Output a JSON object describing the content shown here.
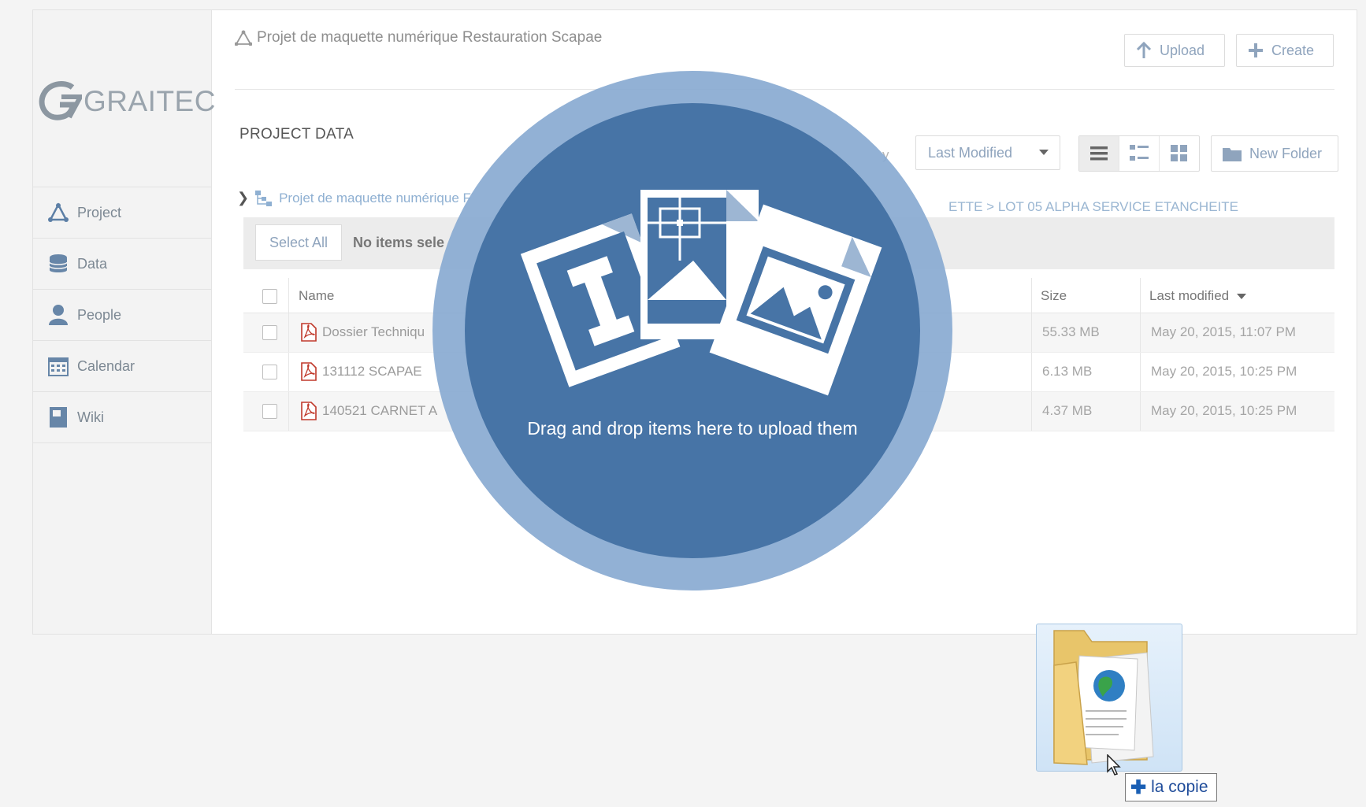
{
  "brand": {
    "logo_text": "GRAITEC"
  },
  "sidebar": {
    "items": [
      {
        "label": "Project",
        "icon": "project-icon"
      },
      {
        "label": "Data",
        "icon": "database-icon"
      },
      {
        "label": "People",
        "icon": "person-icon"
      },
      {
        "label": "Calendar",
        "icon": "calendar-icon"
      },
      {
        "label": "Wiki",
        "icon": "wiki-icon"
      }
    ]
  },
  "header": {
    "project_title": "Projet de maquette numérique Restauration Scapae",
    "upload_label": "Upload",
    "create_label": "Create"
  },
  "section": {
    "title": "PROJECT DATA",
    "sort_hint": "y",
    "sort_value": "Last Modified",
    "new_folder_label": "New Folder",
    "views": [
      "list-view-icon",
      "detail-view-icon",
      "grid-view-icon"
    ]
  },
  "breadcrumb": {
    "first": "Projet de maquette numérique F",
    "end": "ETTE  >  LOT 05 ALPHA SERVICE ETANCHEITE"
  },
  "selection": {
    "select_all_label": "Select All",
    "status": "No items sele"
  },
  "table": {
    "columns": {
      "name": "Name",
      "size": "Size",
      "modified": "Last modified"
    },
    "rows": [
      {
        "name": "Dossier Techniqu",
        "size": "55.33 MB",
        "modified": "May 20, 2015, 11:07 PM"
      },
      {
        "name": "131112 SCAPAE",
        "size": "6.13 MB",
        "modified": "May 20, 2015, 10:25 PM"
      },
      {
        "name": "140521 CARNET A",
        "size": "4.37 MB",
        "modified": "May 20, 2015, 10:25 PM"
      }
    ]
  },
  "dropzone": {
    "message": "Drag and drop items here to upload them"
  },
  "drag": {
    "tooltip_label": "la copie"
  },
  "colors": {
    "accent_blue": "#4774a6",
    "ring_blue": "#89aad1",
    "link_blue": "#8fb0d2",
    "pdf_red": "#c0392b"
  }
}
